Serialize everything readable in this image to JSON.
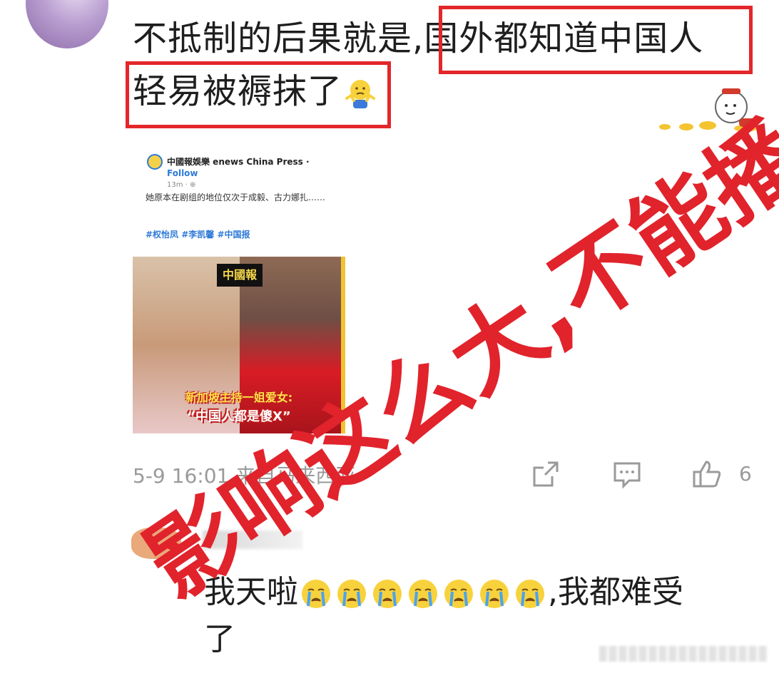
{
  "comment": {
    "line1_plain": "不抵制的后果就是,",
    "line1_highlight": "国外都知道中国人",
    "line2_highlight": "轻易被褥抹了",
    "shrug_icon": "shrug-emoji",
    "highlight_color": "#e3262a"
  },
  "post": {
    "source_name": "中國報娛樂 enews China Press ·",
    "follow_label": "Follow",
    "time": "13m · ⊕",
    "text": "她原本在剧组的地位仅次于成毅、古力娜扎……",
    "tags": "#权怡凤 #李凯馨 #中国报",
    "image": {
      "logo": "中國報",
      "caption_line1": "新加坡主持一姐爱女:",
      "caption_line2": "“中国人都是傻X”"
    }
  },
  "meta": {
    "timestamp_location": "5-9 16:01 来自马来西亚",
    "share_icon": "share-icon",
    "reply_icon": "comment-icon",
    "like_icon": "thumbs-up-icon",
    "like_count": "6"
  },
  "reply": {
    "text_start": "我天啦",
    "text_end": ",我都难受",
    "text_line2": "了",
    "emoji": "crying-face-emoji",
    "emoji_count": 7
  },
  "overlay": {
    "text": "影响这么大,不能播",
    "color": "#e1232c"
  }
}
